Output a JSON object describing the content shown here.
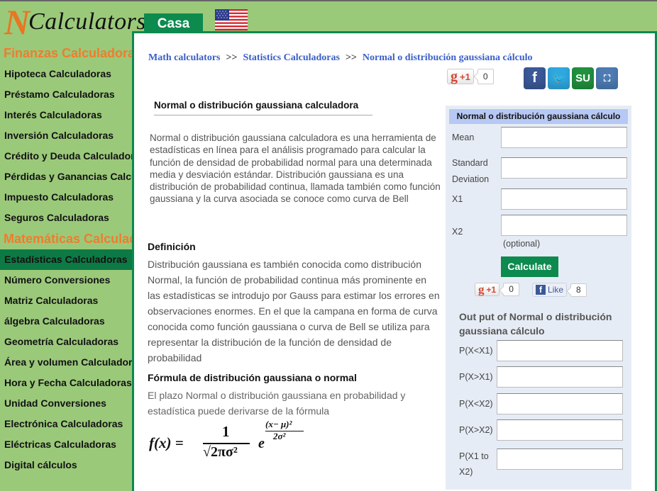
{
  "header": {
    "logo_initial": "N",
    "logo_text": "Calculators",
    "home_tab": "Casa",
    "language_flag": "us-flag-icon"
  },
  "sidebar": {
    "sections": [
      {
        "title": "Finanzas Calculadoras",
        "items": [
          {
            "label": "Hipoteca Calculadoras"
          },
          {
            "label": "Préstamo Calculadoras"
          },
          {
            "label": "Interés Calculadoras"
          },
          {
            "label": "Inversión Calculadoras"
          },
          {
            "label": "Crédito y Deuda Calculadoras"
          },
          {
            "label": "Pérdidas y Ganancias Calculadoras"
          },
          {
            "label": "Impuesto Calculadoras"
          },
          {
            "label": "Seguros Calculadoras"
          }
        ]
      },
      {
        "title": "Matemáticas Calculadoras",
        "items": [
          {
            "label": "Estadísticas Calculadoras",
            "active": true
          },
          {
            "label": "Número Conversiones"
          },
          {
            "label": "Matriz Calculadoras"
          },
          {
            "label": "álgebra Calculadoras"
          },
          {
            "label": "Geometría Calculadoras"
          },
          {
            "label": "Área y volumen Calculadoras"
          },
          {
            "label": "Hora y Fecha Calculadoras"
          },
          {
            "label": "Unidad Conversiones"
          },
          {
            "label": "Electrónica Calculadoras"
          },
          {
            "label": "Eléctricas Calculadoras"
          },
          {
            "label": "Digital cálculos"
          }
        ]
      }
    ]
  },
  "breadcrumb": {
    "items": [
      "Math calculators",
      "Statistics Calculadoras",
      "Normal o distribución gaussiana cálculo"
    ],
    "separator": ">>"
  },
  "social_top": {
    "gplus_label": "+1",
    "gplus_count": "0",
    "share_icons": [
      "facebook-icon",
      "twitter-icon",
      "stumbleupon-icon",
      "myspace-icon"
    ],
    "share_glyphs": [
      "f",
      "🐦",
      "SU",
      "⛶"
    ]
  },
  "article": {
    "title": "Normal o distribución gaussiana calculadora",
    "intro": "Normal o distribución gaussiana calculadora es una herramienta de estadísticas en línea para el análisis programado para calcular la función de densidad de probabilidad normal para una determinada media y desviación estándar. Distribución gaussiana es una distribución de probabilidad continua, llamada también como función gaussiana y la curva asociada se conoce como curva de Bell",
    "definition_heading": "Definición",
    "definition": "Distribución gaussiana es también conocida como distribución Normal, la función de probabilidad continua más prominente en las estadísticas se introdujo por Gauss para estimar los errores en observaciones enormes. En el que la campana en forma de curva conocida como función gaussiana o curva de Bell se utiliza para representar la distribución de la función de densidad de probabilidad",
    "formula_heading": "Fórmula de distribución gaussiana o normal",
    "formula_text": "El plazo Normal o distribución gaussiana en probabilidad y estadística puede derivarse de la fórmula",
    "formula": {
      "lhs": "f(x) =",
      "numerator": "1",
      "denominator": "√2πσ²",
      "base": "e",
      "exp_numerator": "(x− μ)²",
      "exp_denominator": "2σ²"
    }
  },
  "calculator": {
    "title": "Normal o distribución gaussiana cálculo",
    "fields": [
      {
        "label": "Mean",
        "value": ""
      },
      {
        "label": "Standard Deviation",
        "value": ""
      },
      {
        "label": "X1",
        "value": ""
      },
      {
        "label": "X2",
        "value": ""
      }
    ],
    "optional_note": "(optional)",
    "calculate_label": "Calculate",
    "gplus_label": "+1",
    "gplus_count": "0",
    "fb_like_label": "Like",
    "fb_like_count": "8",
    "output_title": "Out put of Normal o distribución gaussiana cálculo",
    "outputs": [
      {
        "label": "P(X<X1)",
        "value": ""
      },
      {
        "label": "P(X>X1)",
        "value": ""
      },
      {
        "label": "P(X<X2)",
        "value": ""
      },
      {
        "label": "P(X>X2)",
        "value": ""
      },
      {
        "label": "P(X1 to X2)",
        "value": ""
      }
    ]
  },
  "colors": {
    "brand_green": "#0d8a4e",
    "sidebar_bg": "#9bc97a",
    "section_orange": "#ef7d2d",
    "link_blue": "#3a5fc8",
    "panel_bg": "#e6ecf5",
    "panel_header": "#b6c8f3"
  }
}
